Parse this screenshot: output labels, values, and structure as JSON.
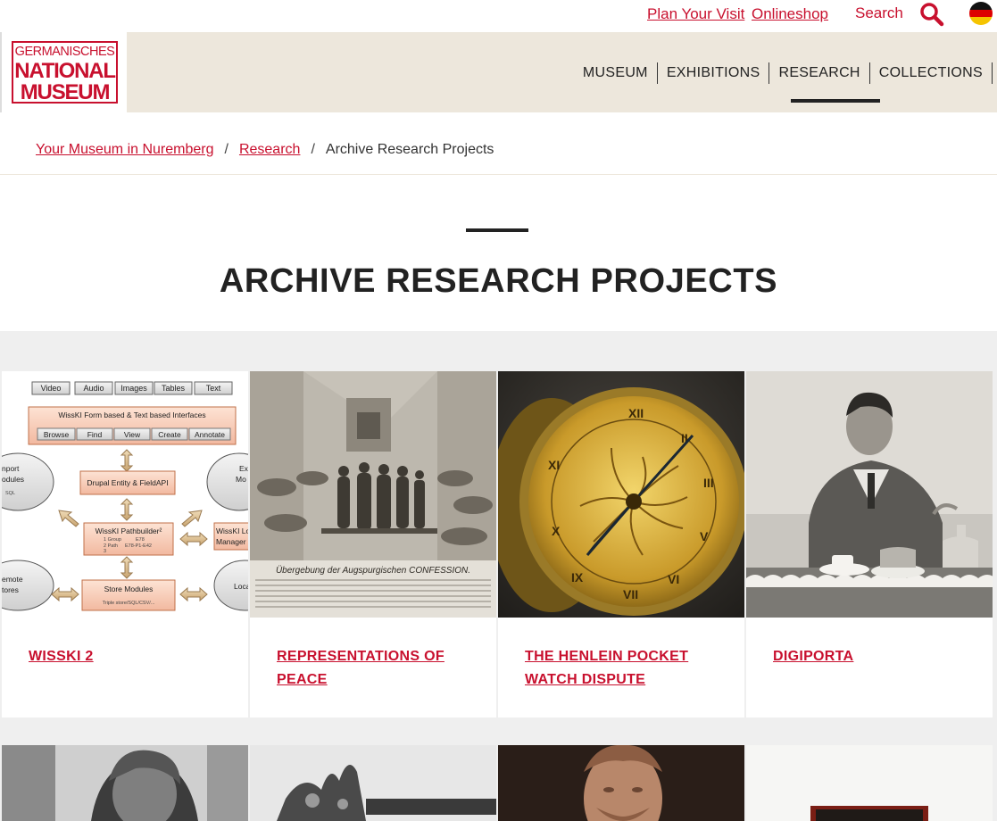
{
  "topbar": {
    "plan_visit": "Plan Your Visit",
    "onlineshop": "Onlineshop",
    "search": "Search"
  },
  "logo": {
    "line1": "GERMANISCHES",
    "line2": "NATIONAL",
    "line3": "MUSEUM"
  },
  "nav": {
    "items": [
      "MUSEUM",
      "EXHIBITIONS",
      "RESEARCH",
      "COLLECTIONS"
    ],
    "active": "RESEARCH"
  },
  "breadcrumb": {
    "items": [
      "Your Museum in Nuremberg",
      "Research"
    ],
    "separator": "/",
    "current": "Archive Research Projects"
  },
  "page": {
    "title": "ARCHIVE RESEARCH PROJECTS"
  },
  "cards": [
    {
      "title": "WISSKI 2",
      "diagram": {
        "media": [
          "Video",
          "Audio",
          "Images",
          "Tables",
          "Text"
        ],
        "interfaces": "WissKI Form based & Text based Interfaces",
        "actions": [
          "Browse",
          "Find",
          "View",
          "Create",
          "Annotate"
        ],
        "drupal": "Drupal Entity & FieldAPI",
        "pathbuilder": "WissKI Pathbuilder²",
        "pathbuilder_rows": [
          "1 Group",
          "E78",
          "2 Path",
          "E78-P1-E42",
          "3"
        ],
        "store": "Store Modules",
        "store_sub": "Triple store/SQL/CSV/...",
        "import": [
          "nport",
          "odules"
        ],
        "import_sub": "SQL",
        "remote": [
          "emote",
          "tores"
        ],
        "export": [
          "Ex",
          "Mo"
        ],
        "local_manager": [
          "WissKI Lo",
          "Manager"
        ],
        "local": "Loca"
      }
    },
    {
      "title": "REPRESENTATIONS OF PEACE",
      "caption": "Übergebung der Augspurgischen CONFESSION."
    },
    {
      "title": "THE HENLEIN POCKET WATCH DISPUTE"
    },
    {
      "title": "DIGIPORTA"
    }
  ],
  "colors": {
    "accent": "#c8102e",
    "header_bg": "#ede7dc",
    "grid_bg": "#efefef"
  }
}
